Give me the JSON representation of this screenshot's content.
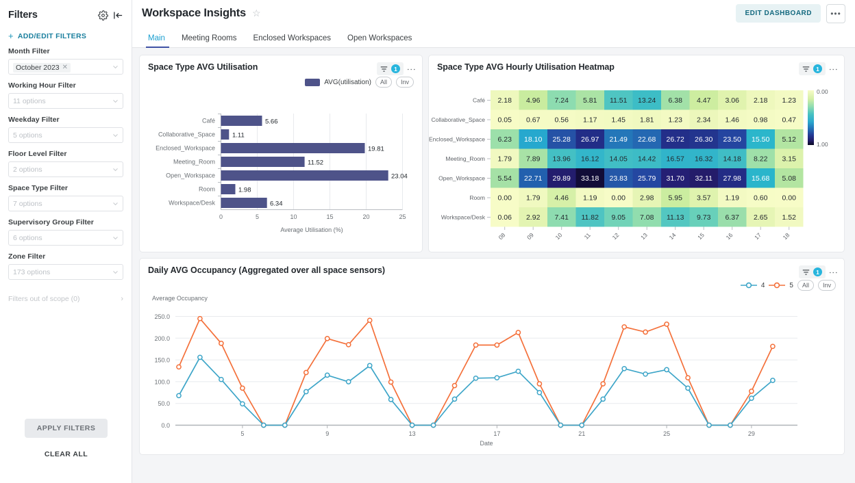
{
  "sidebar": {
    "title": "Filters",
    "gear_icon": "gear-icon",
    "collapse_icon": "collapse-panel-icon",
    "add_edit_label": "ADD/EDIT FILTERS",
    "filters": [
      {
        "label": "Month Filter",
        "value": "October 2023",
        "is_chip": true,
        "placeholder": ""
      },
      {
        "label": "Working Hour Filter",
        "value": "",
        "is_chip": false,
        "placeholder": "11 options"
      },
      {
        "label": "Weekday Filter",
        "value": "",
        "is_chip": false,
        "placeholder": "5 options"
      },
      {
        "label": "Floor Level Filter",
        "value": "",
        "is_chip": false,
        "placeholder": "2 options"
      },
      {
        "label": "Space Type Filter",
        "value": "",
        "is_chip": false,
        "placeholder": "7 options"
      },
      {
        "label": "Supervisory Group Filter",
        "value": "",
        "is_chip": false,
        "placeholder": "6 options"
      },
      {
        "label": "Zone Filter",
        "value": "",
        "is_chip": false,
        "placeholder": "173 options"
      }
    ],
    "out_of_scope_label": "Filters out of scope (0)",
    "apply_label": "APPLY FILTERS",
    "clear_label": "CLEAR ALL"
  },
  "header": {
    "title": "Workspace Insights",
    "star_icon": "star-outline-icon",
    "edit_dashboard_label": "EDIT DASHBOARD",
    "overflow_label": "•••",
    "tabs": [
      {
        "label": "Main",
        "active": true
      },
      {
        "label": "Meeting Rooms",
        "active": false
      },
      {
        "label": "Enclosed Workspaces",
        "active": false
      },
      {
        "label": "Open Workspaces",
        "active": false
      }
    ]
  },
  "panels": {
    "bar": {
      "title": "Space Type AVG Utilisation",
      "filter_badge": "1",
      "legend_label": "AVG(utilisation)",
      "all_label": "All",
      "inv_label": "Inv"
    },
    "heatmap": {
      "title": "Space Type AVG Hourly Utilisation Heatmap",
      "filter_badge": "1"
    },
    "line": {
      "title": "Daily AVG Occupancy (Aggregated over all space sensors)",
      "filter_badge": "1",
      "series_1_label": "4",
      "series_2_label": "5",
      "all_label": "All",
      "inv_label": "Inv"
    }
  },
  "colors": {
    "bar_fill": "#4e5389",
    "accent_teal": "#1a9fd0",
    "badge": "#27b5dd",
    "line_series_1": "#3da5c8",
    "line_series_2": "#f4703a",
    "edit_btn_bg": "#e7f2f4",
    "edit_btn_text": "#14697f",
    "tab_active": "#1a9fd0",
    "tab_underline": "#3f51a5"
  },
  "chart_data": [
    {
      "type": "bar",
      "title": "Space Type AVG Utilisation",
      "orientation": "horizontal",
      "xlabel": "Average Utilisation (%)",
      "ylabel": "",
      "xlim": [
        0,
        25
      ],
      "xticks": [
        0,
        5,
        10,
        15,
        20,
        25
      ],
      "grid": true,
      "legend": [
        "AVG(utilisation)"
      ],
      "categories": [
        "Café",
        "Collaborative_Space",
        "Enclosed_Workspace",
        "Meeting_Room",
        "Open_Workspace",
        "Room",
        "Workspace/Desk"
      ],
      "values": [
        5.66,
        1.11,
        19.81,
        11.52,
        23.04,
        1.98,
        6.34
      ],
      "value_labels": [
        "5.66",
        "1.11",
        "19.81",
        "11.52",
        "23.04",
        "1.98",
        "6.34"
      ]
    },
    {
      "type": "heatmap",
      "title": "Space Type AVG Hourly Utilisation Heatmap",
      "xlabel": "",
      "ylabel": "",
      "x": [
        "08",
        "09",
        "10",
        "11",
        "12",
        "13",
        "14",
        "15",
        "16",
        "17",
        "18"
      ],
      "y": [
        "Café",
        "Collaborative_Space",
        "Enclosed_Workspace",
        "Meeting_Room",
        "Open_Workspace",
        "Room",
        "Workspace/Desk"
      ],
      "colorbar": {
        "min_label": "0.00",
        "max_label": "1.00",
        "scale": "YlGnBu"
      },
      "values": [
        [
          2.18,
          4.96,
          7.24,
          5.81,
          11.51,
          13.24,
          6.38,
          4.47,
          3.06,
          2.18,
          1.23
        ],
        [
          0.05,
          0.67,
          0.56,
          1.17,
          1.45,
          1.81,
          1.23,
          2.34,
          1.46,
          0.98,
          0.47
        ],
        [
          6.23,
          18.1,
          25.28,
          26.97,
          21.49,
          22.68,
          26.72,
          26.3,
          23.5,
          15.5,
          5.12
        ],
        [
          1.79,
          7.89,
          13.96,
          16.12,
          14.05,
          14.42,
          16.57,
          16.32,
          14.18,
          8.22,
          3.15
        ],
        [
          5.54,
          22.71,
          29.89,
          33.18,
          23.83,
          25.79,
          31.7,
          32.11,
          27.98,
          15.68,
          5.08
        ],
        [
          0.0,
          1.79,
          4.46,
          1.19,
          0.0,
          2.98,
          5.95,
          3.57,
          1.19,
          0.6,
          0.0
        ],
        [
          0.06,
          2.92,
          7.41,
          11.82,
          9.05,
          7.08,
          11.13,
          9.73,
          6.37,
          2.65,
          1.52
        ]
      ],
      "cell_labels": [
        [
          "2.18",
          "4.96",
          "7.24",
          "5.81",
          "11.51",
          "13.24",
          "6.38",
          "4.47",
          "3.06",
          "2.18",
          "1.23"
        ],
        [
          "0.05",
          "0.67",
          "0.56",
          "1.17",
          "1.45",
          "1.81",
          "1.23",
          "2.34",
          "1.46",
          "0.98",
          "0.47"
        ],
        [
          "6.23",
          "18.10",
          "25.28",
          "26.97",
          "21.49",
          "22.68",
          "26.72",
          "26.30",
          "23.50",
          "15.50",
          "5.12"
        ],
        [
          "1.79",
          "7.89",
          "13.96",
          "16.12",
          "14.05",
          "14.42",
          "16.57",
          "16.32",
          "14.18",
          "8.22",
          "3.15"
        ],
        [
          "5.54",
          "22.71",
          "29.89",
          "33.18",
          "23.83",
          "25.79",
          "31.70",
          "32.11",
          "27.98",
          "15.68",
          "5.08"
        ],
        [
          "0.00",
          "1.79",
          "4.46",
          "1.19",
          "0.00",
          "2.98",
          "5.95",
          "3.57",
          "1.19",
          "0.60",
          "0.00"
        ],
        [
          "0.06",
          "2.92",
          "7.41",
          "11.82",
          "9.05",
          "7.08",
          "11.13",
          "9.73",
          "6.37",
          "2.65",
          "1.52"
        ]
      ]
    },
    {
      "type": "line",
      "title": "Daily AVG Occupancy (Aggregated over all space sensors)",
      "xlabel": "Date",
      "ylabel": "Average Occupancy",
      "ylim": [
        0,
        250
      ],
      "yticks": [
        0.0,
        50.0,
        100.0,
        150.0,
        200.0,
        250.0
      ],
      "ytick_labels": [
        "0.0",
        "50.0",
        "100.0",
        "150.0",
        "200.0",
        "250.0"
      ],
      "xticks": [
        5,
        9,
        13,
        17,
        21,
        25,
        29
      ],
      "xtick_labels": [
        "5",
        "9",
        "13",
        "17",
        "21",
        "25",
        "29"
      ],
      "xlim": [
        2,
        31
      ],
      "grid": true,
      "legend_position": "top-right",
      "x": [
        2,
        3,
        4,
        5,
        6,
        7,
        8,
        9,
        10,
        11,
        12,
        13,
        14,
        15,
        16,
        17,
        18,
        19,
        20,
        21,
        22,
        23,
        24,
        25,
        26,
        27,
        28,
        29,
        30,
        31
      ],
      "series": [
        {
          "name": "4",
          "color": "#3da5c8",
          "values": [
            68,
            156,
            105,
            49,
            0,
            0,
            77,
            115,
            100,
            137,
            59,
            0,
            0,
            60,
            108,
            109,
            124,
            75,
            0,
            0,
            60,
            130,
            117,
            128,
            85,
            0,
            0,
            62,
            103,
            null
          ]
        },
        {
          "name": "5",
          "color": "#f4703a",
          "values": [
            134,
            245,
            188,
            85,
            0,
            0,
            121,
            199,
            185,
            241,
            99,
            0,
            0,
            91,
            184,
            184,
            213,
            95,
            0,
            0,
            95,
            226,
            214,
            232,
            109,
            0,
            0,
            78,
            181,
            null
          ]
        }
      ]
    }
  ]
}
